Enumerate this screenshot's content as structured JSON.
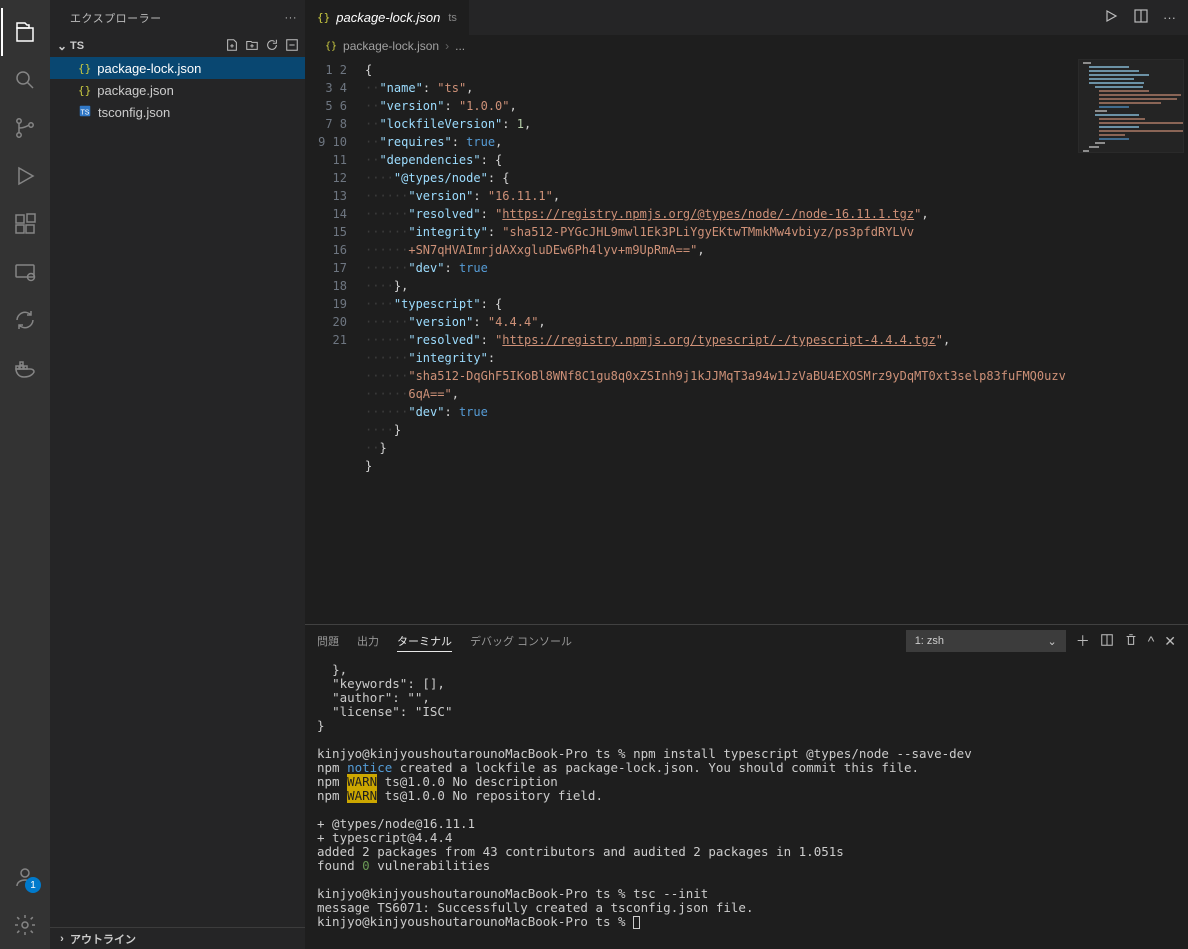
{
  "sidebar": {
    "title": "エクスプローラー",
    "section": "TS",
    "outline": "アウトライン",
    "files": [
      {
        "name": "package-lock.json",
        "icon": "{}",
        "selected": true
      },
      {
        "name": "package.json",
        "icon": "{}",
        "selected": false
      },
      {
        "name": "tsconfig.json",
        "icon": "ts",
        "selected": false
      }
    ]
  },
  "tab": {
    "name": "package-lock.json",
    "icon": "{}",
    "folder": "ts"
  },
  "breadcrumb": {
    "file": "package-lock.json",
    "tail": "..."
  },
  "accounts_badge": "1",
  "code": {
    "line_numbers": [
      "1",
      "2",
      "3",
      "4",
      "5",
      "6",
      "7",
      "8",
      "9",
      "10",
      "",
      "11",
      "12",
      "13",
      "14",
      "15",
      "16",
      "",
      "",
      "17",
      "18",
      "19",
      "20",
      "21"
    ],
    "lines": [
      [
        {
          "t": "punc",
          "v": "{"
        }
      ],
      [
        {
          "t": "dot",
          "v": "··"
        },
        {
          "t": "key",
          "v": "\"name\""
        },
        {
          "t": "punc",
          "v": ": "
        },
        {
          "t": "str",
          "v": "\"ts\""
        },
        {
          "t": "punc",
          "v": ","
        }
      ],
      [
        {
          "t": "dot",
          "v": "··"
        },
        {
          "t": "key",
          "v": "\"version\""
        },
        {
          "t": "punc",
          "v": ": "
        },
        {
          "t": "str",
          "v": "\"1.0.0\""
        },
        {
          "t": "punc",
          "v": ","
        }
      ],
      [
        {
          "t": "dot",
          "v": "··"
        },
        {
          "t": "key",
          "v": "\"lockfileVersion\""
        },
        {
          "t": "punc",
          "v": ": "
        },
        {
          "t": "num",
          "v": "1"
        },
        {
          "t": "punc",
          "v": ","
        }
      ],
      [
        {
          "t": "dot",
          "v": "··"
        },
        {
          "t": "key",
          "v": "\"requires\""
        },
        {
          "t": "punc",
          "v": ": "
        },
        {
          "t": "bool",
          "v": "true"
        },
        {
          "t": "punc",
          "v": ","
        }
      ],
      [
        {
          "t": "dot",
          "v": "··"
        },
        {
          "t": "key",
          "v": "\"dependencies\""
        },
        {
          "t": "punc",
          "v": ": {"
        }
      ],
      [
        {
          "t": "dot",
          "v": "····"
        },
        {
          "t": "key",
          "v": "\"@types/node\""
        },
        {
          "t": "punc",
          "v": ": {"
        }
      ],
      [
        {
          "t": "dot",
          "v": "······"
        },
        {
          "t": "key",
          "v": "\"version\""
        },
        {
          "t": "punc",
          "v": ": "
        },
        {
          "t": "str",
          "v": "\"16.11.1\""
        },
        {
          "t": "punc",
          "v": ","
        }
      ],
      [
        {
          "t": "dot",
          "v": "······"
        },
        {
          "t": "key",
          "v": "\"resolved\""
        },
        {
          "t": "punc",
          "v": ": "
        },
        {
          "t": "str",
          "v": "\""
        },
        {
          "t": "link",
          "v": "https://registry.npmjs.org/@types/node/-/node-16.11.1.tgz"
        },
        {
          "t": "str",
          "v": "\""
        },
        {
          "t": "punc",
          "v": ","
        }
      ],
      [
        {
          "t": "dot",
          "v": "······"
        },
        {
          "t": "key",
          "v": "\"integrity\""
        },
        {
          "t": "punc",
          "v": ": "
        },
        {
          "t": "str",
          "v": "\"sha512-PYGcJHL9mwl1Ek3PLiYgyEKtwTMmkMw4vbiyz/ps3pfdRYLVv"
        }
      ],
      [
        {
          "t": "dot",
          "v": "······"
        },
        {
          "t": "str",
          "v": "+SN7qHVAImrjdAXxgluDEw6Ph4lyv+m9UpRmA==\""
        },
        {
          "t": "punc",
          "v": ","
        }
      ],
      [
        {
          "t": "dot",
          "v": "······"
        },
        {
          "t": "key",
          "v": "\"dev\""
        },
        {
          "t": "punc",
          "v": ": "
        },
        {
          "t": "bool",
          "v": "true"
        }
      ],
      [
        {
          "t": "dot",
          "v": "····"
        },
        {
          "t": "punc",
          "v": "},"
        }
      ],
      [
        {
          "t": "dot",
          "v": "····"
        },
        {
          "t": "key",
          "v": "\"typescript\""
        },
        {
          "t": "punc",
          "v": ": {"
        }
      ],
      [
        {
          "t": "dot",
          "v": "······"
        },
        {
          "t": "key",
          "v": "\"version\""
        },
        {
          "t": "punc",
          "v": ": "
        },
        {
          "t": "str",
          "v": "\"4.4.4\""
        },
        {
          "t": "punc",
          "v": ","
        }
      ],
      [
        {
          "t": "dot",
          "v": "······"
        },
        {
          "t": "key",
          "v": "\"resolved\""
        },
        {
          "t": "punc",
          "v": ": "
        },
        {
          "t": "str",
          "v": "\""
        },
        {
          "t": "link",
          "v": "https://registry.npmjs.org/typescript/-/typescript-4.4.4.tgz"
        },
        {
          "t": "str",
          "v": "\""
        },
        {
          "t": "punc",
          "v": ","
        }
      ],
      [
        {
          "t": "dot",
          "v": "······"
        },
        {
          "t": "key",
          "v": "\"integrity\""
        },
        {
          "t": "punc",
          "v": ": "
        }
      ],
      [
        {
          "t": "dot",
          "v": "······"
        },
        {
          "t": "str",
          "v": "\"sha512-DqGhF5IKoBl8WNf8C1gu8q0xZSInh9j1kJJMqT3a94w1JzVaBU4EXOSMrz9yDqMT0xt3selp83fuFMQ0uzv"
        }
      ],
      [
        {
          "t": "dot",
          "v": "······"
        },
        {
          "t": "str",
          "v": "6qA==\""
        },
        {
          "t": "punc",
          "v": ","
        }
      ],
      [
        {
          "t": "dot",
          "v": "······"
        },
        {
          "t": "key",
          "v": "\"dev\""
        },
        {
          "t": "punc",
          "v": ": "
        },
        {
          "t": "bool",
          "v": "true"
        }
      ],
      [
        {
          "t": "dot",
          "v": "····"
        },
        {
          "t": "punc",
          "v": "}"
        }
      ],
      [
        {
          "t": "dot",
          "v": "··"
        },
        {
          "t": "punc",
          "v": "}"
        }
      ],
      [
        {
          "t": "punc",
          "v": "}"
        }
      ],
      []
    ]
  },
  "panel": {
    "tabs": {
      "problems": "問題",
      "output": "出力",
      "terminal": "ターミナル",
      "debug": "デバッグ コンソール"
    },
    "picker": "1: zsh"
  },
  "terminal_lines": [
    "  },",
    "  \"keywords\": [],",
    "  \"author\": \"\",",
    "  \"license\": \"ISC\"",
    "}",
    "",
    "kinjyo@kinjyoushoutarounoMacBook-Pro ts % npm install typescript @types/node --save-dev",
    "npm |notice| created a lockfile as package-lock.json. You should commit this file.",
    "npm |WARN| ts@1.0.0 No description",
    "npm |WARN| ts@1.0.0 No repository field.",
    "",
    "+ @types/node@16.11.1",
    "+ typescript@4.4.4",
    "added 2 packages from 43 contributors and audited 2 packages in 1.051s",
    "found |0| vulnerabilities",
    "",
    "kinjyo@kinjyoushoutarounoMacBook-Pro ts % tsc --init",
    "message TS6071: Successfully created a tsconfig.json file.",
    "kinjyo@kinjyoushoutarounoMacBook-Pro ts % "
  ]
}
